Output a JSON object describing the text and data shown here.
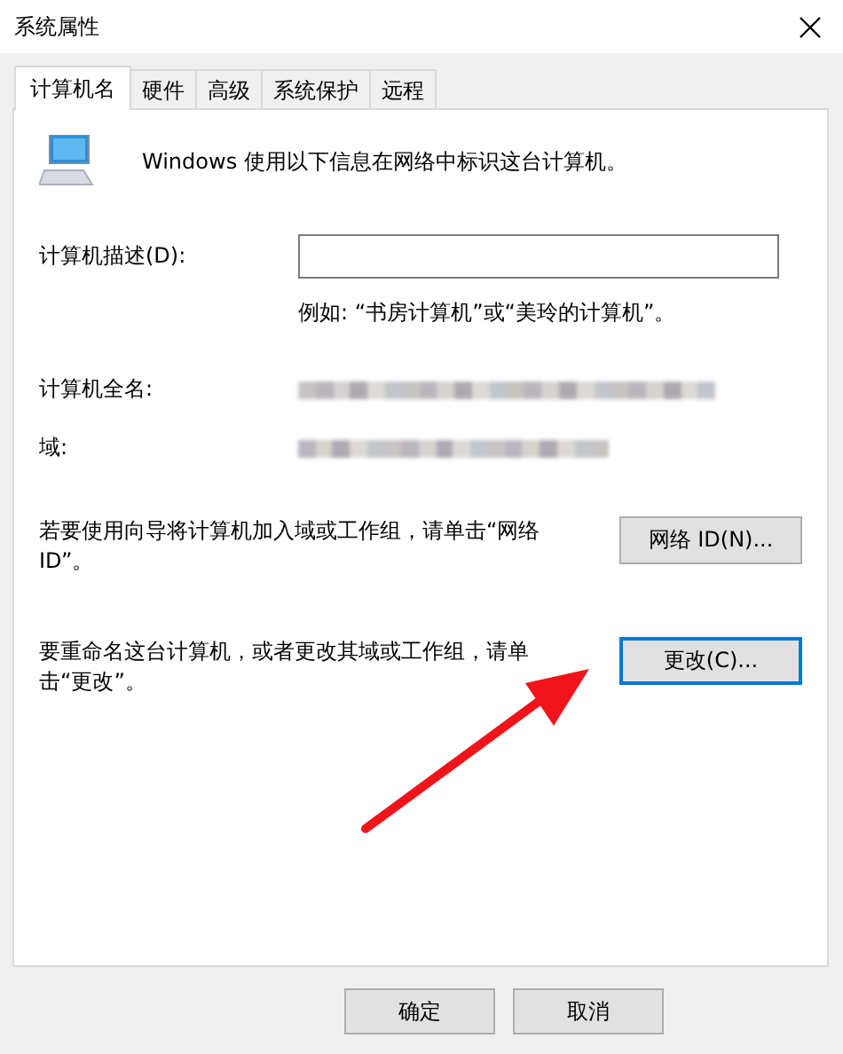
{
  "window": {
    "title": "系统属性"
  },
  "tabs": [
    {
      "label": "计算机名",
      "selected": true
    },
    {
      "label": "硬件",
      "selected": false
    },
    {
      "label": "高级",
      "selected": false
    },
    {
      "label": "系统保护",
      "selected": false
    },
    {
      "label": "远程",
      "selected": false
    }
  ],
  "intro": "Windows 使用以下信息在网络中标识这台计算机。",
  "description": {
    "label": "计算机描述(D):",
    "example": "例如: “书房计算机”或“美玲的计算机”。"
  },
  "info_rows": [
    {
      "label": "计算机全名:"
    },
    {
      "label": "域:"
    }
  ],
  "actions": [
    {
      "text": "若要使用向导将计算机加入域或工作组，请单击“网络 ID”。",
      "button": "网络 ID(N)...",
      "focused": false
    },
    {
      "text": "要重命名这台计算机，或者更改其域或工作组，请单击“更改”。",
      "button": "更改(C)...",
      "focused": true
    }
  ],
  "buttons": [
    "确定",
    "取消"
  ]
}
